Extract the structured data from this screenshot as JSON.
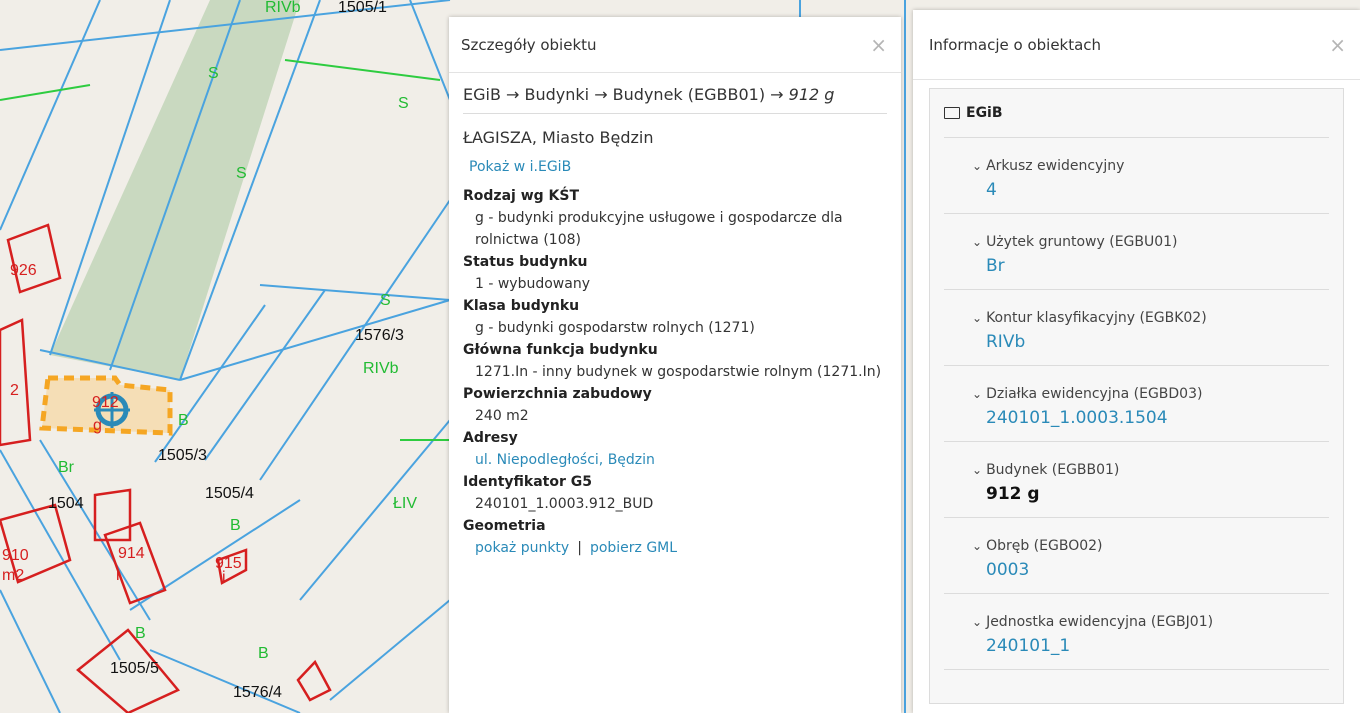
{
  "map": {
    "labels": [
      {
        "text": "RIVb",
        "color": "green"
      },
      {
        "text": "1505/1",
        "color": "black"
      },
      {
        "text": "S",
        "color": "green"
      },
      {
        "text": "S",
        "color": "green"
      },
      {
        "text": "S",
        "color": "green"
      },
      {
        "text": "S",
        "color": "green"
      },
      {
        "text": "1576/3",
        "color": "black"
      },
      {
        "text": "RIVb",
        "color": "green"
      },
      {
        "text": "B",
        "color": "green"
      },
      {
        "text": "1505/3",
        "color": "black"
      },
      {
        "text": "Br",
        "color": "green"
      },
      {
        "text": "1504",
        "color": "black"
      },
      {
        "text": "1505/4",
        "color": "black"
      },
      {
        "text": "B",
        "color": "green"
      },
      {
        "text": "ŁIV",
        "color": "green"
      },
      {
        "text": "B",
        "color": "green"
      },
      {
        "text": "1505/5",
        "color": "black"
      },
      {
        "text": "B",
        "color": "green"
      },
      {
        "text": "1576/4",
        "color": "black"
      },
      {
        "text": "926",
        "color": "red"
      },
      {
        "text": "910",
        "color": "red"
      },
      {
        "text": "m2",
        "color": "red"
      },
      {
        "text": "914",
        "color": "red"
      },
      {
        "text": "i",
        "color": "red"
      },
      {
        "text": "915",
        "color": "red"
      },
      {
        "text": "i",
        "color": "red"
      },
      {
        "text": "912",
        "color": "red"
      },
      {
        "text": "g",
        "color": "red"
      },
      {
        "text": "2",
        "color": "red"
      }
    ]
  },
  "details": {
    "title": "Szczegóły obiektu",
    "close": "×",
    "breadcrumb": "EGiB → Budynki → Budynek (EGBB01) → ",
    "breadcrumb_last": "912 g",
    "location": "ŁAGISZA, Miasto Będzin",
    "show_link": "Pokaż w i.EGiB",
    "attributes": [
      {
        "title": "Rodzaj wg KŚT",
        "value": "g - budynki produkcyjne usługowe i gospodarcze dla rolnictwa (108)",
        "link": false
      },
      {
        "title": "Status budynku",
        "value": "1 - wybudowany",
        "link": false
      },
      {
        "title": "Klasa budynku",
        "value": "g - budynki gospodarstw rolnych (1271)",
        "link": false
      },
      {
        "title": "Główna funkcja budynku",
        "value": "1271.In - inny budynek w gospodarstwie rolnym (1271.In)",
        "link": false
      },
      {
        "title": "Powierzchnia zabudowy",
        "value": "240 m2",
        "link": false
      },
      {
        "title": "Adresy",
        "value": "ul. Niepodległości, Będzin",
        "link": true
      },
      {
        "title": "Identyfikator G5",
        "value": "240101_1.0003.912_BUD",
        "link": false
      }
    ],
    "geometry_title": "Geometria",
    "geometry_links": [
      "pokaż punkty",
      "pobierz GML"
    ],
    "geometry_sep": "|"
  },
  "info": {
    "title": "Informacje o obiektach",
    "close": "×",
    "root_label": "EGiB",
    "nodes": [
      {
        "label": "Arkusz ewidencyjny",
        "value": "4",
        "bold": false
      },
      {
        "label": "Użytek gruntowy (EGBU01)",
        "value": "Br",
        "bold": false
      },
      {
        "label": "Kontur klasyfikacyjny (EGBK02)",
        "value": "RIVb",
        "bold": false
      },
      {
        "label": "Działka ewidencyjna (EGBD03)",
        "value": "240101_1.0003.1504",
        "bold": false
      },
      {
        "label": "Budynek (EGBB01)",
        "value": "912 g",
        "bold": true
      },
      {
        "label": "Obręb (EGBO02)",
        "value": "0003",
        "bold": false
      },
      {
        "label": "Jednostka ewidencyjna (EGBJ01)",
        "value": "240101_1",
        "bold": false
      }
    ]
  },
  "colors": {
    "parcel_line": "#4aa3df",
    "land_use_line": "#2ecc40",
    "building": "#d61f1f",
    "selection": "#f5a623",
    "link": "#2a8ab8"
  }
}
